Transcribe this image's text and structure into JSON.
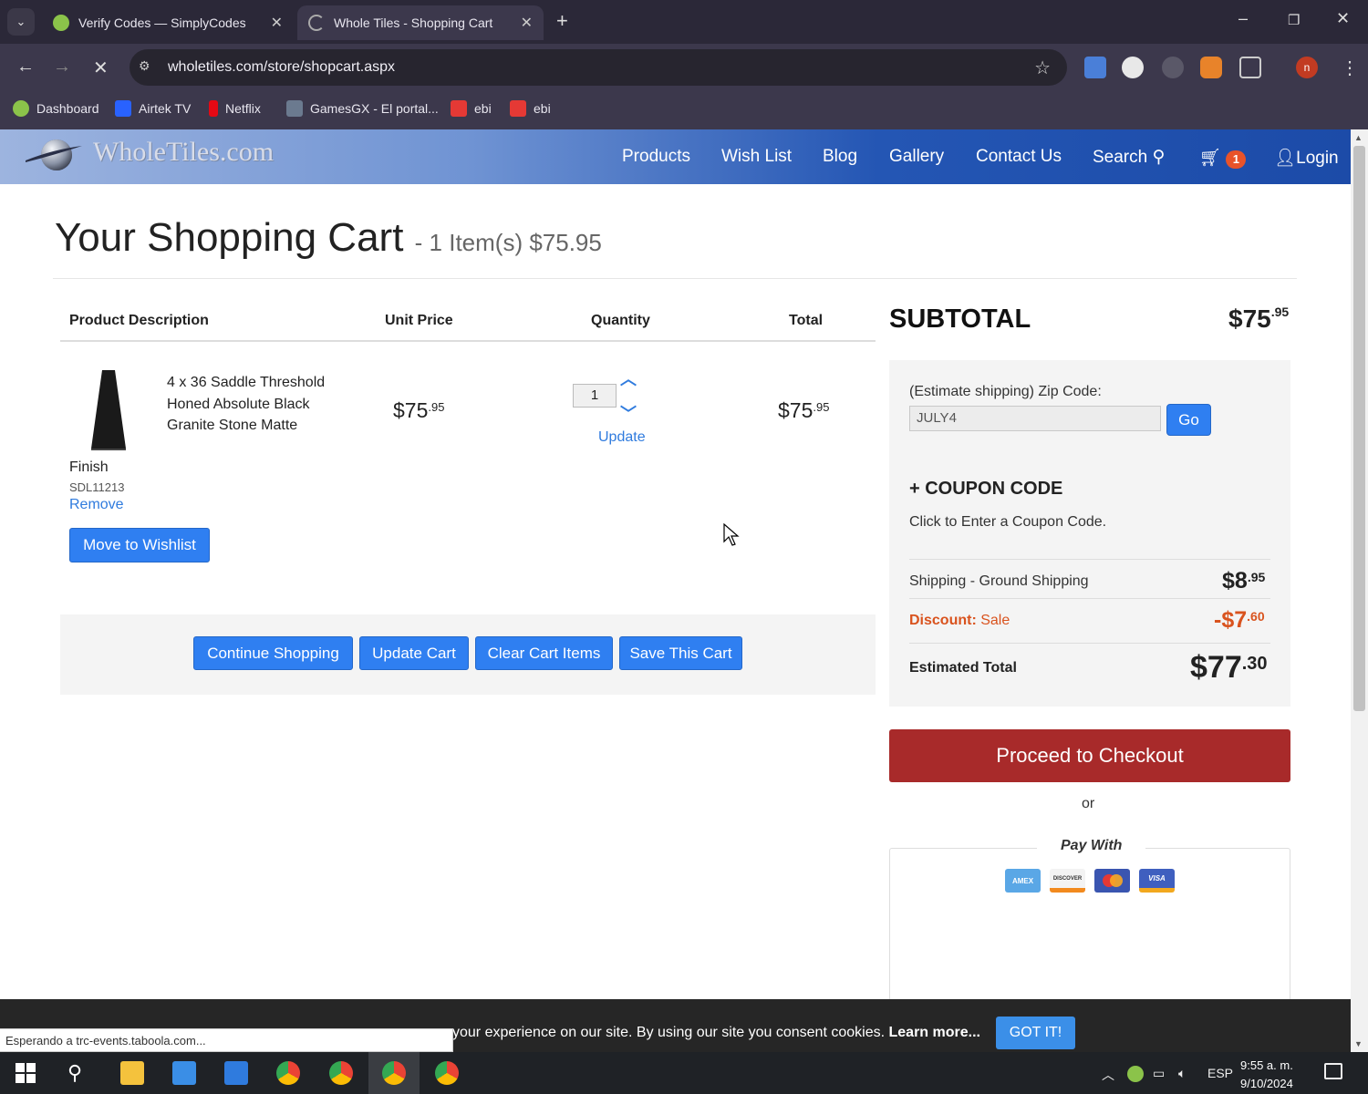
{
  "browser": {
    "tabs": [
      {
        "title": "Verify Codes — SimplyCodes"
      },
      {
        "title": "Whole Tiles - Shopping Cart"
      }
    ],
    "url": "wholetiles.com/store/shopcart.aspx",
    "profile_initial": "n",
    "bookmarks": [
      "Dashboard",
      "Airtek TV",
      "Netflix",
      "GamesGX - El portal...",
      "ebi",
      "ebi"
    ],
    "status_text": "Esperando a trc-events.taboola.com..."
  },
  "site": {
    "logo_text": "WholeTiles.com",
    "nav": [
      "Products",
      "Wish List",
      "Blog",
      "Gallery",
      "Contact Us",
      "Search",
      "Login"
    ],
    "cart_count": "1"
  },
  "cart": {
    "title": "Your Shopping Cart",
    "summary": "- 1 Item(s) $75.95",
    "columns": [
      "Product Description",
      "Unit Price",
      "Quantity",
      "Total"
    ],
    "item": {
      "name": "4 x 36 Saddle Threshold Honed Absolute Black Granite Stone Matte",
      "name_last": "Finish",
      "sku": "SDL11213",
      "remove_label": "Remove",
      "wishlist_label": "Move to Wishlist",
      "unit_price_main": "$75",
      "unit_price_cents": ".95",
      "quantity": "1",
      "update_label": "Update",
      "total_main": "$75",
      "total_cents": ".95"
    },
    "actions": [
      "Continue Shopping",
      "Update Cart",
      "Clear Cart Items",
      "Save This Cart"
    ]
  },
  "summary": {
    "subtotal_label": "SUBTOTAL",
    "subtotal_main": "$75",
    "subtotal_cents": ".95",
    "zip_label": "(Estimate shipping) Zip Code:",
    "zip_value": "JULY4",
    "go_label": "Go",
    "coupon_title": "+ COUPON CODE",
    "coupon_hint": "Click to Enter a Coupon Code.",
    "shipping_label": "Shipping - Ground Shipping",
    "shipping_main": "$8",
    "shipping_cents": ".95",
    "discount_label": "Discount:",
    "discount_note": "Sale",
    "discount_main": "-$7",
    "discount_cents": ".60",
    "estimated_label": "Estimated Total",
    "estimated_main": "$77",
    "estimated_cents": ".30",
    "checkout_label": "Proceed to Checkout",
    "or_label": "or",
    "paywith_label": "Pay With",
    "cards": [
      "AMEX",
      "DISCOVER",
      "",
      "VISA"
    ]
  },
  "cookie": {
    "text": "your experience on our site. By using our site you consent cookies.",
    "learn_more": "Learn more...",
    "button": "GOT IT!"
  },
  "taskbar": {
    "language": "ESP",
    "time": "9:55 a. m.",
    "date": "9/10/2024"
  },
  "colors": {
    "accent_blue": "#2f7ff1",
    "checkout_red": "#a82a2a",
    "discount_orange": "#d9531e",
    "header_dark": "#1c4ba8"
  }
}
